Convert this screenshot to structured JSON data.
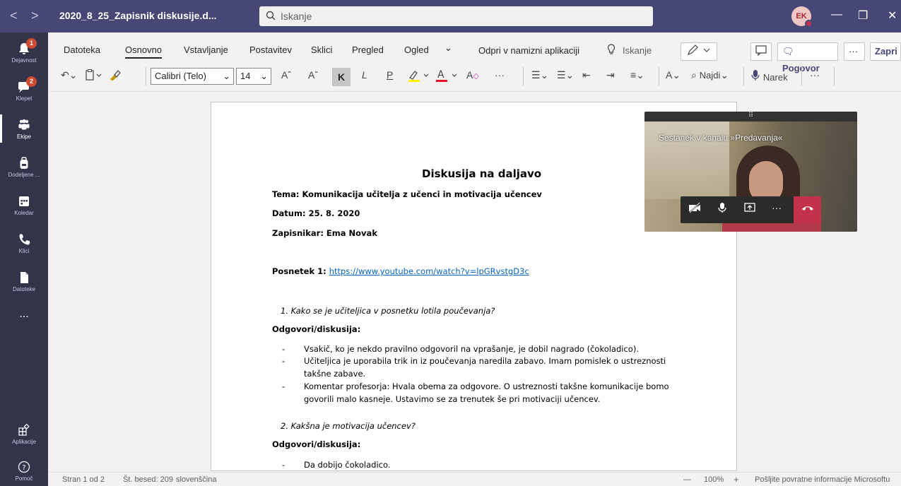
{
  "titlebar": {
    "doc_title": "2020_8_25_Zapisnik diskusije.d...",
    "search_placeholder": "Iskanje",
    "avatar_initials": "EK",
    "back": "<",
    "forward": ">",
    "minimize": "—",
    "restore": "❐",
    "close": "✕"
  },
  "rail": {
    "items": [
      {
        "label": "Dejavnost",
        "badge": "1"
      },
      {
        "label": "Klepet",
        "badge": "2"
      },
      {
        "label": "Ekipe",
        "badge": ""
      },
      {
        "label": "Dodeljene ...",
        "badge": ""
      },
      {
        "label": "Koledar",
        "badge": ""
      },
      {
        "label": "Klici",
        "badge": ""
      },
      {
        "label": "Datoteke",
        "badge": ""
      },
      {
        "label": "...",
        "badge": ""
      }
    ],
    "apps_label": "Aplikacije",
    "help_label": "Pomoč"
  },
  "ribbon": {
    "tabs": [
      "Datoteka",
      "Osnovno",
      "Vstavljanje",
      "Postavitev",
      "Sklici",
      "Pregled",
      "Ogled"
    ],
    "more_tabs": "⌄",
    "open_desktop": "Odpri v namizni aplikaciji",
    "search": "Iskanje",
    "conversation": "Pogovor",
    "more": "···",
    "close_doc": "Zapri",
    "font_name": "Calibri (Telo)",
    "font_size": "14",
    "bold": "K",
    "italic": "L",
    "underline": "P",
    "find": "Najdi",
    "dictate": "Narek"
  },
  "document": {
    "title": "Diskusija na daljavo",
    "topic": "Tema: Komunikacija učitelja z učenci in motivacija učencev",
    "date": "Datum: 25. 8. 2020",
    "recorder": "Zapisnikar: Ema Novak",
    "video_label": "Posnetek 1: ",
    "video_link": "https://www.youtube.com/watch?v=lpGRvstgD3c",
    "q1": "1.   Kako se je učiteljica v posnetku lotila poučevanja?",
    "answers_heading": "Odgovori/diskusija:",
    "a1": [
      "Vsakič, ko je nekdo pravilno odgovoril na vprašanje, je dobil nagrado (čokoladico).",
      "Učiteljica je uporabila trik in iz poučevanja naredila zabavo. Imam pomislek o ustreznosti",
      "takšne zabave.",
      "Komentar profesorja: Hvala obema za odgovore. O ustreznosti takšne komunikacije bomo",
      "govorili malo kasneje. Ustavimo se za trenutek še pri motivaciji učencev."
    ],
    "q2": "2.   Kakšna je motivacija učencev?",
    "answers_heading_2": "Odgovori/diskusija:",
    "a2": [
      "Da dobijo čokoladico."
    ]
  },
  "meeting": {
    "title": "Sestanek v kanalu »Predavanja«"
  },
  "statusbar": {
    "page": "Stran 1 od 2",
    "words": "Št. besed: 209",
    "language": "slovenščina",
    "zoom_minus": "—",
    "zoom": "100%",
    "zoom_plus": "+",
    "feedback": "Pošljite povratne informacije Microsoftu"
  }
}
